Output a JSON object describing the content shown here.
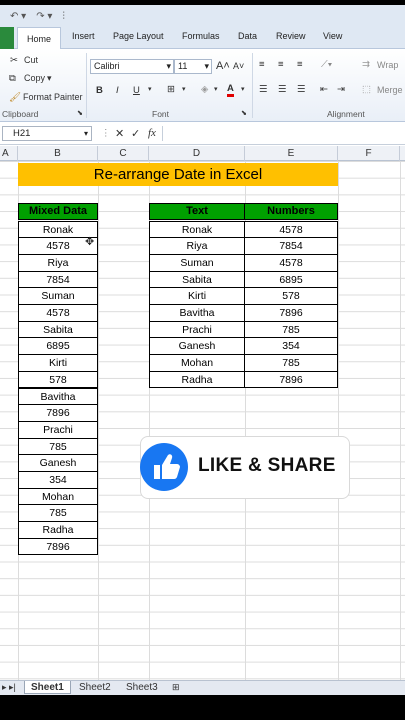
{
  "ribbon": {
    "tabs": [
      "Home",
      "Insert",
      "Page Layout",
      "Formulas",
      "Data",
      "Review",
      "View"
    ],
    "clipboard": {
      "cut": "Cut",
      "copy": "Copy",
      "format_painter": "Format Painter",
      "group": "Clipboard"
    },
    "font": {
      "name": "Calibri",
      "size": "11",
      "group": "Font"
    },
    "alignment": {
      "wrap": "Wrap",
      "merge": "Merge",
      "group": "Alignment"
    }
  },
  "formula_bar": {
    "name_box": "H21",
    "fx": "fx",
    "value": ""
  },
  "columns": [
    "A",
    "B",
    "C",
    "D",
    "E",
    "F"
  ],
  "sheet": {
    "title": "Re-arrange Date in Excel",
    "mixed": {
      "header": "Mixed Data",
      "rows": [
        "Ronak",
        "4578",
        "Riya",
        "7854",
        "Suman",
        "4578",
        "Sabita",
        "6895",
        "Kirti",
        "578",
        "Bavitha",
        "7896",
        "Prachi",
        "785",
        "Ganesh",
        "354",
        "Mohan",
        "785",
        "Radha",
        "7896"
      ]
    },
    "result": {
      "headers": [
        "Text",
        "Numbers"
      ],
      "rows": [
        [
          "Ronak",
          "4578"
        ],
        [
          "Riya",
          "7854"
        ],
        [
          "Suman",
          "4578"
        ],
        [
          "Sabita",
          "6895"
        ],
        [
          "Kirti",
          "578"
        ],
        [
          "Bavitha",
          "7896"
        ],
        [
          "Prachi",
          "785"
        ],
        [
          "Ganesh",
          "354"
        ],
        [
          "Mohan",
          "785"
        ],
        [
          "Radha",
          "7896"
        ]
      ]
    }
  },
  "overlay": {
    "text": "LIKE & SHARE",
    "icon": "thumbs-up-icon"
  },
  "sheet_tabs": [
    "Sheet1",
    "Sheet2",
    "Sheet3"
  ],
  "colors": {
    "title_bg": "#ffc000",
    "header_bg": "#00a000",
    "like_blue": "#1877f2",
    "file_tab": "#2a8a3c"
  }
}
